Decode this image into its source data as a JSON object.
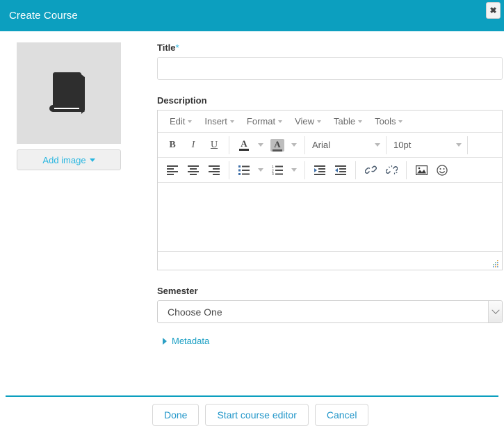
{
  "header": {
    "title": "Create Course",
    "close_label": "✖",
    "accent_color": "#0c9fbf"
  },
  "image_panel": {
    "icon_name": "book-icon",
    "add_image_label": "Add image"
  },
  "form": {
    "title_label": "Title",
    "title_required_mark": "*",
    "title_value": "",
    "title_placeholder": "",
    "description_label": "Description",
    "semester_label": "Semester",
    "semester_value": "Choose One",
    "metadata_label": "Metadata"
  },
  "editor": {
    "menus": [
      {
        "label": "Edit"
      },
      {
        "label": "Insert"
      },
      {
        "label": "Format"
      },
      {
        "label": "View"
      },
      {
        "label": "Table"
      },
      {
        "label": "Tools"
      }
    ],
    "toolbar_row1": {
      "bold": "B",
      "italic": "I",
      "underline": "U",
      "text_color": "A",
      "background_color": "A",
      "font_family": "Arial",
      "font_size": "10pt"
    },
    "content": ""
  },
  "footer": {
    "buttons": [
      {
        "label": "Done"
      },
      {
        "label": "Start course editor"
      },
      {
        "label": "Cancel"
      }
    ]
  }
}
